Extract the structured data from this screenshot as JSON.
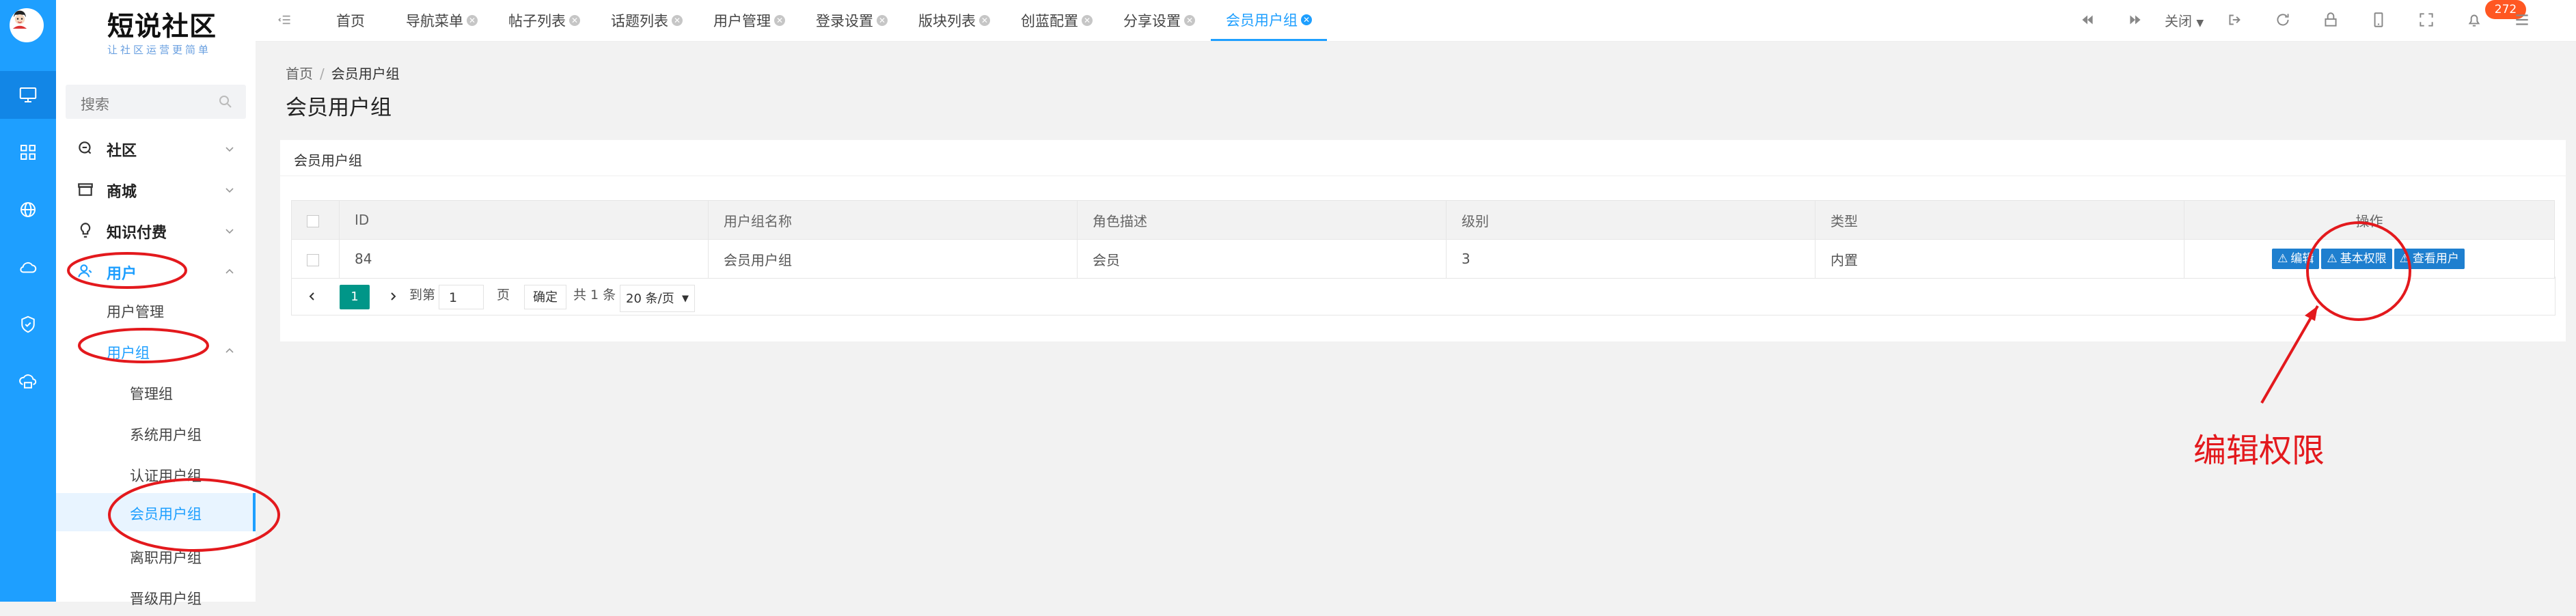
{
  "logo": {
    "title": "短说社区",
    "subtitle": "让社区运营更简单"
  },
  "search": {
    "placeholder": "搜索"
  },
  "menu": [
    {
      "label": "社区",
      "icon": "community-icon"
    },
    {
      "label": "商城",
      "icon": "shop-icon"
    },
    {
      "label": "知识付费",
      "icon": "bulb-icon"
    },
    {
      "label": "用户",
      "icon": "user-icon"
    }
  ],
  "user_sub": {
    "manage": "用户管理",
    "groups": "用户组"
  },
  "group_sub": [
    "管理组",
    "系统用户组",
    "认证用户组",
    "会员用户组",
    "离职用户组",
    "晋级用户组"
  ],
  "tabs": [
    "首页",
    "导航菜单",
    "帖子列表",
    "话题列表",
    "用户管理",
    "登录设置",
    "版块列表",
    "创蓝配置",
    "分享设置",
    "会员用户组"
  ],
  "close_label": "关闭",
  "notifications": "272",
  "breadcrumb": {
    "home": "首页",
    "current": "会员用户组"
  },
  "page_title": "会员用户组",
  "card_title": "会员用户组",
  "table": {
    "headers": [
      "ID",
      "用户组名称",
      "角色描述",
      "级别",
      "类型",
      "操作"
    ],
    "rows": [
      {
        "id": "84",
        "name": "会员用户组",
        "role": "会员",
        "level": "3",
        "type": "内置"
      }
    ],
    "actions": [
      "编辑",
      "基本权限",
      "查看用户"
    ]
  },
  "pagination": {
    "current": "1",
    "goto": "到第",
    "page_value": "1",
    "page_unit": "页",
    "confirm": "确定",
    "total": "共 1 条",
    "size": "20 条/页"
  },
  "annotation": "编辑权限",
  "colors": {
    "primary": "#1e9fff",
    "annotation": "#e3191d",
    "badge": "#ff5722",
    "pager": "#009688"
  }
}
